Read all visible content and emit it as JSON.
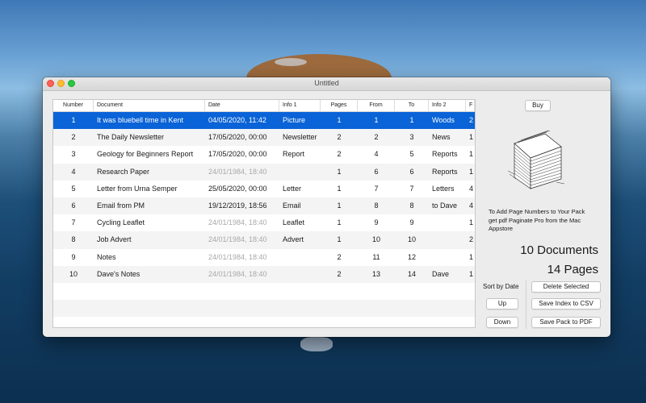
{
  "window": {
    "title": "Untitled"
  },
  "table": {
    "headers": [
      "Number",
      "Document",
      "Date",
      "Info 1",
      "Pages",
      "From",
      "To",
      "Info 2",
      "F"
    ],
    "rows": [
      {
        "num": "1",
        "doc": "It was bluebell time in Kent",
        "date": "04/05/2020, 11:42",
        "info1": "Picture",
        "pages": "1",
        "from": "1",
        "to": "1",
        "info2": "Woods",
        "f": "2",
        "selected": true
      },
      {
        "num": "2",
        "doc": "The Daily Newsletter",
        "date": "17/05/2020, 00:00",
        "info1": "Newsletter",
        "pages": "2",
        "from": "2",
        "to": "3",
        "info2": "News",
        "f": "1"
      },
      {
        "num": "3",
        "doc": "Geology for Beginners Report",
        "date": "17/05/2020, 00:00",
        "info1": "Report",
        "pages": "2",
        "from": "4",
        "to": "5",
        "info2": "Reports",
        "f": "1"
      },
      {
        "num": "4",
        "doc": "Research Paper",
        "date": "24/01/1984, 18:40",
        "info1": "",
        "pages": "1",
        "from": "6",
        "to": "6",
        "info2": "Reports",
        "f": "1",
        "dim": true
      },
      {
        "num": "5",
        "doc": "Letter from Urna Semper",
        "date": "25/05/2020, 00:00",
        "info1": "Letter",
        "pages": "1",
        "from": "7",
        "to": "7",
        "info2": "Letters",
        "f": "4"
      },
      {
        "num": "6",
        "doc": "Email from PM",
        "date": "19/12/2019, 18:56",
        "info1": "Email",
        "pages": "1",
        "from": "8",
        "to": "8",
        "info2": "to Dave",
        "f": "4"
      },
      {
        "num": "7",
        "doc": "Cycling Leaflet",
        "date": "24/01/1984, 18:40",
        "info1": "Leaflet",
        "pages": "1",
        "from": "9",
        "to": "9",
        "info2": "",
        "f": "1",
        "dim": true
      },
      {
        "num": "8",
        "doc": "Job Advert",
        "date": "24/01/1984, 18:40",
        "info1": "Advert",
        "pages": "1",
        "from": "10",
        "to": "10",
        "info2": "",
        "f": "2",
        "dim": true
      },
      {
        "num": "9",
        "doc": "Notes",
        "date": "24/01/1984, 18:40",
        "info1": "",
        "pages": "2",
        "from": "11",
        "to": "12",
        "info2": "",
        "f": "1",
        "dim": true
      },
      {
        "num": "10",
        "doc": "Dave's Notes",
        "date": "24/01/1984, 18:40",
        "info1": "",
        "pages": "2",
        "from": "13",
        "to": "14",
        "info2": "Dave",
        "f": "1",
        "dim": true
      }
    ]
  },
  "side": {
    "buy_label": "Buy",
    "info_text": "To Add Page Numbers to Your Pack get pdf Paginate Pro from the Mac Appstore",
    "documents_count": "10 Documents",
    "pages_count": "14 Pages",
    "sort_label": "Sort by Date",
    "up_label": "Up",
    "down_label": "Down",
    "delete_label": "Delete Selected",
    "save_csv_label": "Save Index to CSV",
    "save_pdf_label": "Save Pack to PDF"
  },
  "icons": {
    "stack": "paper-stack-icon"
  },
  "colors": {
    "selection": "#0a63d7",
    "close": "#fe5f57",
    "minimize": "#febc2e",
    "maximize": "#28c840"
  }
}
